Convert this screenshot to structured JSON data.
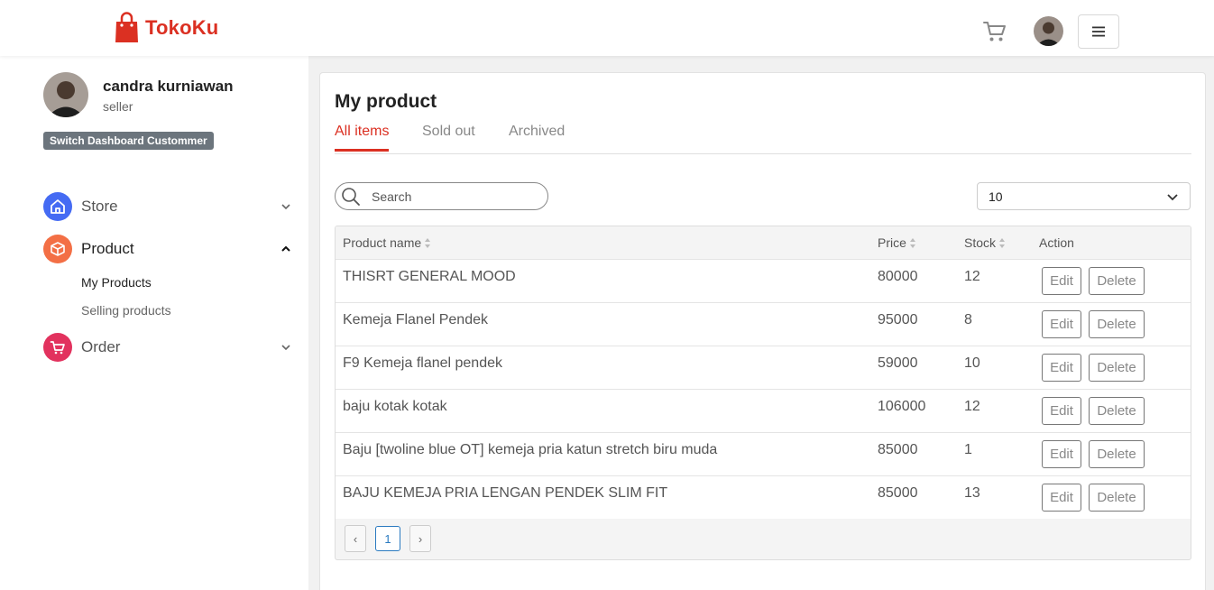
{
  "brand": {
    "name": "TokoKu",
    "color": "#db3022"
  },
  "header": {
    "cart_icon": "shopping-cart-icon",
    "avatar_icon": "user-avatar",
    "menu_icon": "hamburger-menu-icon"
  },
  "profile": {
    "name": "candra kurniawan",
    "role": "seller",
    "switch_label": "Switch Dashboard Custommer"
  },
  "sidebar": {
    "store": {
      "label": "Store",
      "icon": "store-icon",
      "color": "#456bf3"
    },
    "product": {
      "label": "Product",
      "icon": "box-icon",
      "color": "#f36f45"
    },
    "product_subitems": [
      "My Products",
      "Selling products"
    ],
    "order": {
      "label": "Order",
      "icon": "cart-icon",
      "color": "#e2325e"
    }
  },
  "main": {
    "title": "My product",
    "tabs": [
      "All items",
      "Sold out",
      "Archived"
    ],
    "active_tab": "All items",
    "search_placeholder": "Search",
    "page_size": "10",
    "columns": [
      "Product name",
      "Price",
      "Stock",
      "Action"
    ],
    "edit_label": "Edit",
    "delete_label": "Delete",
    "rows": [
      {
        "name": "THISRT GENERAL MOOD",
        "price": "80000",
        "stock": "12"
      },
      {
        "name": "Kemeja Flanel Pendek",
        "price": "95000",
        "stock": "8"
      },
      {
        "name": "F9 Kemeja flanel pendek",
        "price": "59000",
        "stock": "10"
      },
      {
        "name": "baju kotak kotak",
        "price": "106000",
        "stock": "12"
      },
      {
        "name": "Baju [twoline blue OT] kemeja pria katun stretch biru muda",
        "price": "85000",
        "stock": "1"
      },
      {
        "name": "BAJU KEMEJA PRIA LENGAN PENDEK SLIM FIT",
        "price": "85000",
        "stock": "13"
      }
    ],
    "pagination": {
      "prev": "‹",
      "current": "1",
      "next": "›"
    }
  }
}
